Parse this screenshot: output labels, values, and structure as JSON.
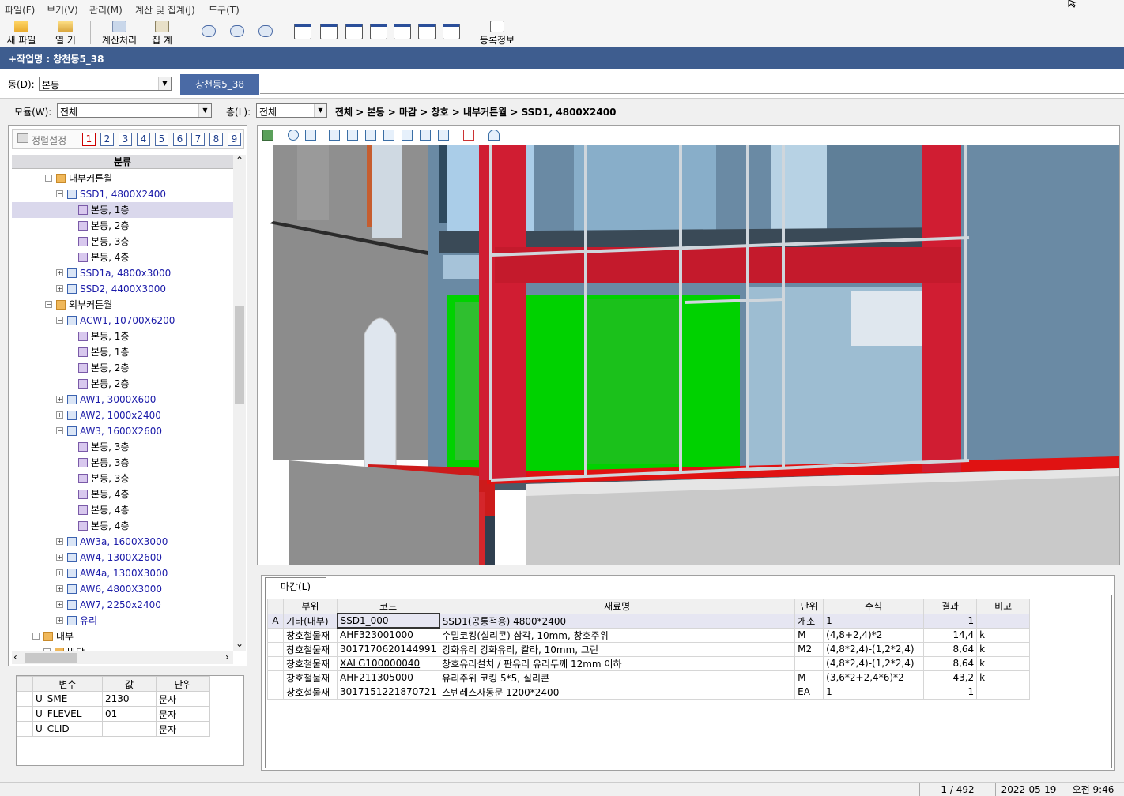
{
  "menu": [
    "파일(F)",
    "보기(V)",
    "관리(M)",
    "계산 및 집계(J)",
    "도구(T)"
  ],
  "toolbar": {
    "new_file": "새 파일",
    "open": "열   기",
    "calc": "계산처리",
    "aggregate": "집   계",
    "reg_info": "등록정보"
  },
  "work_title": "+작업명 : 창천동5_38",
  "dong": {
    "label": "동(D):",
    "value": "본동",
    "tab": "창천동5_38"
  },
  "module": {
    "label": "모듈(W):",
    "value": "전체"
  },
  "floor": {
    "label": "층(L):",
    "value": "전체"
  },
  "breadcrumb": "전체 > 본동 > 마감 > 창호 > 내부커튼월 > SSD1, 4800X2400",
  "sort": {
    "label": "정렬설정",
    "numbers": [
      "1",
      "2",
      "3",
      "4",
      "5",
      "6",
      "7",
      "8",
      "9"
    ]
  },
  "tree": {
    "header": "분류",
    "items": [
      {
        "label": "내부커튼월",
        "kind": "folder",
        "exp": "−"
      },
      {
        "label": "SSD1, 4800X2400",
        "kind": "group",
        "exp": "−"
      },
      {
        "label": "본동, 1층",
        "kind": "leaf",
        "selected": true
      },
      {
        "label": "본동, 2층",
        "kind": "leaf"
      },
      {
        "label": "본동, 3층",
        "kind": "leaf"
      },
      {
        "label": "본동, 4층",
        "kind": "leaf"
      },
      {
        "label": "SSD1a, 4800x3000",
        "kind": "group",
        "exp": "+"
      },
      {
        "label": "SSD2, 4400X3000",
        "kind": "group",
        "exp": "+"
      },
      {
        "label": "외부커튼월",
        "kind": "folder",
        "exp": "−"
      },
      {
        "label": "ACW1, 10700X6200",
        "kind": "group",
        "exp": "−"
      },
      {
        "label": "본동, 1층",
        "kind": "leaf"
      },
      {
        "label": "본동, 1층",
        "kind": "leaf"
      },
      {
        "label": "본동, 2층",
        "kind": "leaf"
      },
      {
        "label": "본동, 2층",
        "kind": "leaf"
      },
      {
        "label": "AW1, 3000X600",
        "kind": "group",
        "exp": "+"
      },
      {
        "label": "AW2, 1000x2400",
        "kind": "group",
        "exp": "+"
      },
      {
        "label": "AW3, 1600X2600",
        "kind": "group",
        "exp": "−"
      },
      {
        "label": "본동, 3층",
        "kind": "leaf"
      },
      {
        "label": "본동, 3층",
        "kind": "leaf"
      },
      {
        "label": "본동, 3층",
        "kind": "leaf"
      },
      {
        "label": "본동, 4층",
        "kind": "leaf"
      },
      {
        "label": "본동, 4층",
        "kind": "leaf"
      },
      {
        "label": "본동, 4층",
        "kind": "leaf"
      },
      {
        "label": "AW3a, 1600X3000",
        "kind": "group",
        "exp": "+"
      },
      {
        "label": "AW4, 1300X2600",
        "kind": "group",
        "exp": "+"
      },
      {
        "label": "AW4a, 1300X3000",
        "kind": "group",
        "exp": "+"
      },
      {
        "label": "AW6, 4800X3000",
        "kind": "group",
        "exp": "+"
      },
      {
        "label": "AW7, 2250x2400",
        "kind": "group",
        "exp": "+"
      },
      {
        "label": "유리",
        "kind": "group",
        "exp": "+"
      },
      {
        "label": "내부",
        "kind": "folder-top",
        "exp": "−"
      },
      {
        "label": "바닥",
        "kind": "folder-sub",
        "exp": "−"
      }
    ]
  },
  "variables": {
    "headers": [
      "변수",
      "값",
      "단위"
    ],
    "rows": [
      {
        "name": "U_SME",
        "value": "2130",
        "unit": "문자"
      },
      {
        "name": "U_FLEVEL",
        "value": "01",
        "unit": "문자"
      },
      {
        "name": "U_CLID",
        "value": "",
        "unit": "문자"
      }
    ]
  },
  "materials": {
    "tab": "마감(L)",
    "headers": [
      "부위",
      "코드",
      "재료명",
      "단위",
      "수식",
      "결과",
      "비고"
    ],
    "rows": [
      {
        "mark": "A",
        "part": "기타(내부)",
        "code": "SSD1_000",
        "name": "SSD1(공통적용)  4800*2400",
        "unit": "개소",
        "formula": "1",
        "result": "1",
        "note": ""
      },
      {
        "mark": "",
        "part": "창호철물재",
        "code": "AHF323001000",
        "name": "수밀코킹(실리콘)  삼각, 10mm, 창호주위",
        "unit": "M",
        "formula": "(4,8+2,4)*2",
        "result": "14,4",
        "note": "k"
      },
      {
        "mark": "",
        "part": "창호철물재",
        "code": "3017170620144991",
        "name": "강화유리  강화유리, 칼라, 10mm, 그린",
        "unit": "M2",
        "formula": "(4,8*2,4)-(1,2*2,4)",
        "result": "8,64",
        "note": "k"
      },
      {
        "mark": "",
        "part": "창호철물재",
        "code": "XALG100000040",
        "name": "창호유리설치 / 판유리  유리두께 12mm 이하",
        "unit": "",
        "formula": "(4,8*2,4)-(1,2*2,4)",
        "result": "8,64",
        "note": "k"
      },
      {
        "mark": "",
        "part": "창호철물재",
        "code": "AHF211305000",
        "name": "유리주위 코킹  5*5, 실리콘",
        "unit": "M",
        "formula": "(3,6*2+2,4*6)*2",
        "result": "43,2",
        "note": "k"
      },
      {
        "mark": "",
        "part": "창호철물재",
        "code": "3017151221870721",
        "name": "스텐레스자동문  1200*2400",
        "unit": "EA",
        "formula": "1",
        "result": "1",
        "note": ""
      }
    ]
  },
  "status": {
    "page": "1 / 492",
    "date": "2022-05-19",
    "time": "오전 9:46"
  },
  "colors": {
    "title_bar": "#3e5d8f",
    "tab_active": "#4a6aa5",
    "highlight": "#00e600",
    "frame_red": "#d01d32"
  }
}
